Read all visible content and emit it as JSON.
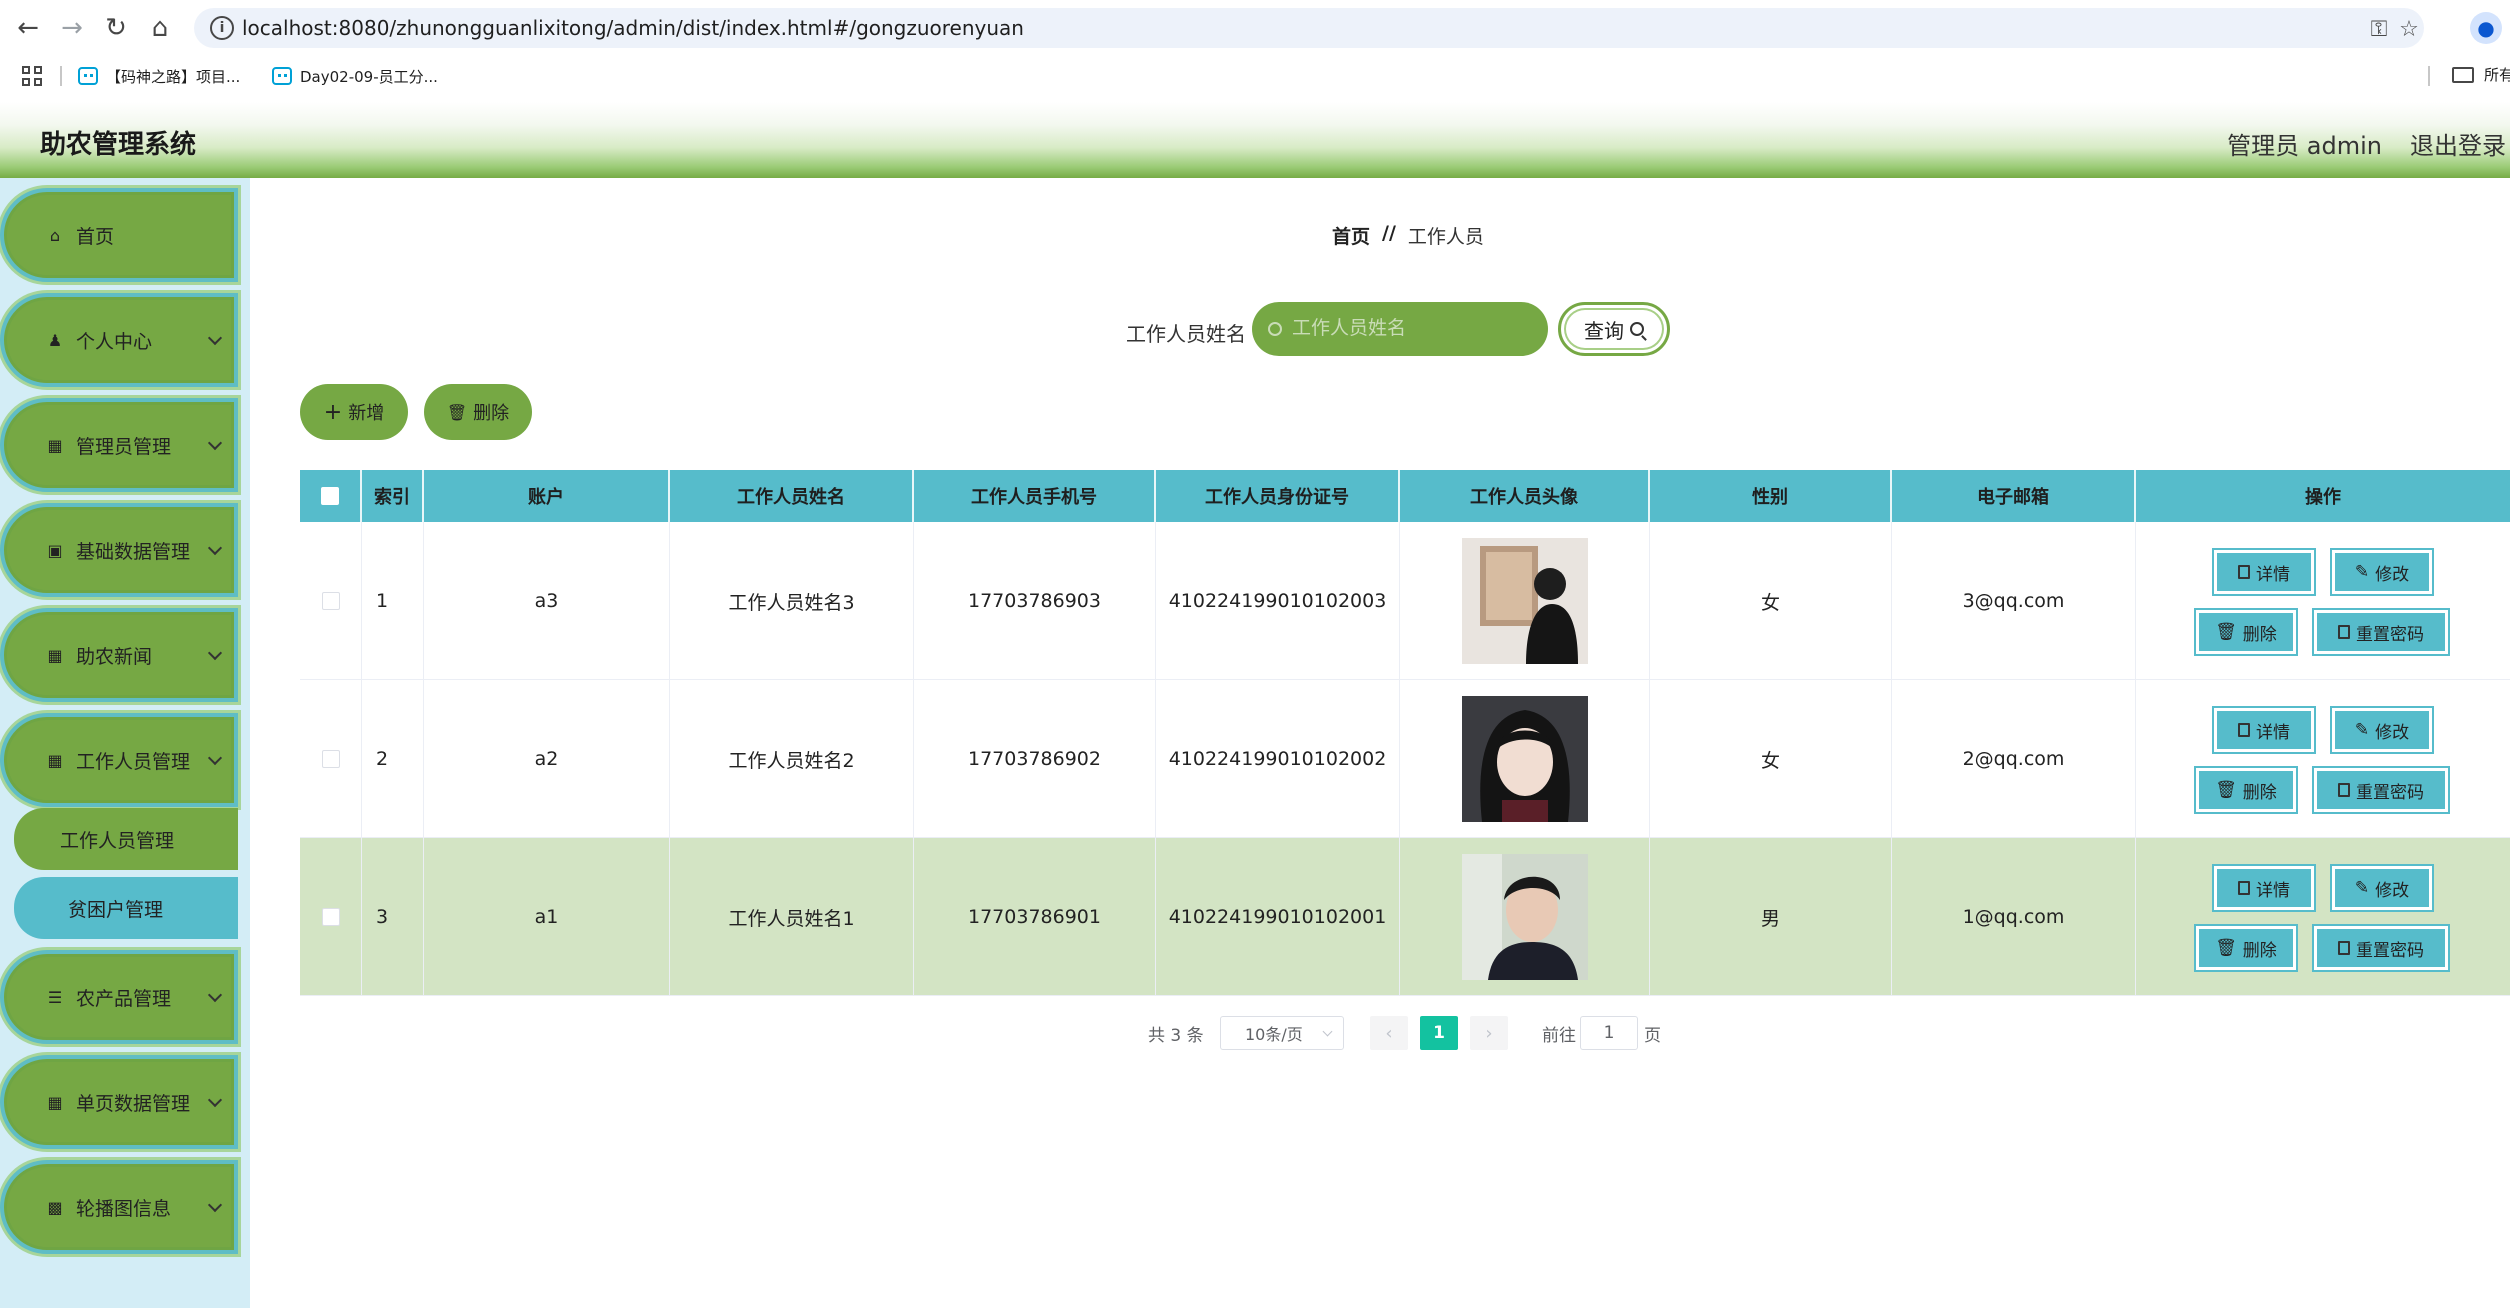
{
  "browser": {
    "url": "localhost:8080/zhunongguanlixitong/admin/dist/index.html#/gongzuorenyuan",
    "bookmarks": [
      "【码神之路】项目...",
      "Day02-09-员工分..."
    ],
    "all_bookmarks": "所有"
  },
  "header": {
    "title": "助农管理系统",
    "admin": "管理员 admin",
    "logout": "退出登录"
  },
  "sidebar": {
    "items": [
      {
        "label": "首页",
        "icon": "home-icon"
      },
      {
        "label": "个人中心",
        "icon": "user-icon"
      },
      {
        "label": "管理员管理",
        "icon": "grid-icon"
      },
      {
        "label": "基础数据管理",
        "icon": "database-icon"
      },
      {
        "label": "助农新闻",
        "icon": "grid-icon"
      },
      {
        "label": "工作人员管理",
        "icon": "grid-icon"
      },
      {
        "label": "农产品管理",
        "icon": "sliders-icon"
      },
      {
        "label": "单页数据管理",
        "icon": "grid-icon"
      },
      {
        "label": "轮播图信息",
        "icon": "chart-icon"
      }
    ],
    "sub_items": [
      "工作人员管理",
      "贫困户管理"
    ]
  },
  "breadcrumb": {
    "home": "首页",
    "sep": "//",
    "current": "工作人员"
  },
  "search": {
    "label": "工作人员姓名",
    "placeholder": "工作人员姓名",
    "button": "查询"
  },
  "actions": {
    "add": "新增",
    "delete": "删除"
  },
  "table": {
    "columns": [
      "索引",
      "账户",
      "工作人员姓名",
      "工作人员手机号",
      "工作人员身份证号",
      "工作人员头像",
      "性别",
      "电子邮箱",
      "操作"
    ],
    "rows": [
      {
        "index": "1",
        "account": "a3",
        "name": "工作人员姓名3",
        "phone": "17703786903",
        "id_no": "410224199010102003",
        "gender": "女",
        "email": "3@qq.com"
      },
      {
        "index": "2",
        "account": "a2",
        "name": "工作人员姓名2",
        "phone": "17703786902",
        "id_no": "410224199010102002",
        "gender": "女",
        "email": "2@qq.com"
      },
      {
        "index": "3",
        "account": "a1",
        "name": "工作人员姓名1",
        "phone": "17703786901",
        "id_no": "410224199010102001",
        "gender": "男",
        "email": "1@qq.com"
      }
    ],
    "row_actions": {
      "detail": "详情",
      "edit": "修改",
      "delete": "删除",
      "reset": "重置密码"
    }
  },
  "pagination": {
    "total": "共 3 条",
    "page_size": "10条/页",
    "current": "1",
    "goto": "前往",
    "goto_value": "1",
    "page_unit": "页"
  },
  "colors": {
    "accent_green": "#76a844",
    "accent_teal": "#56bccb",
    "sidebar_bg": "#d3edf6",
    "highlight_row": "#d3e4c4",
    "pager_active": "#13c2a0"
  }
}
